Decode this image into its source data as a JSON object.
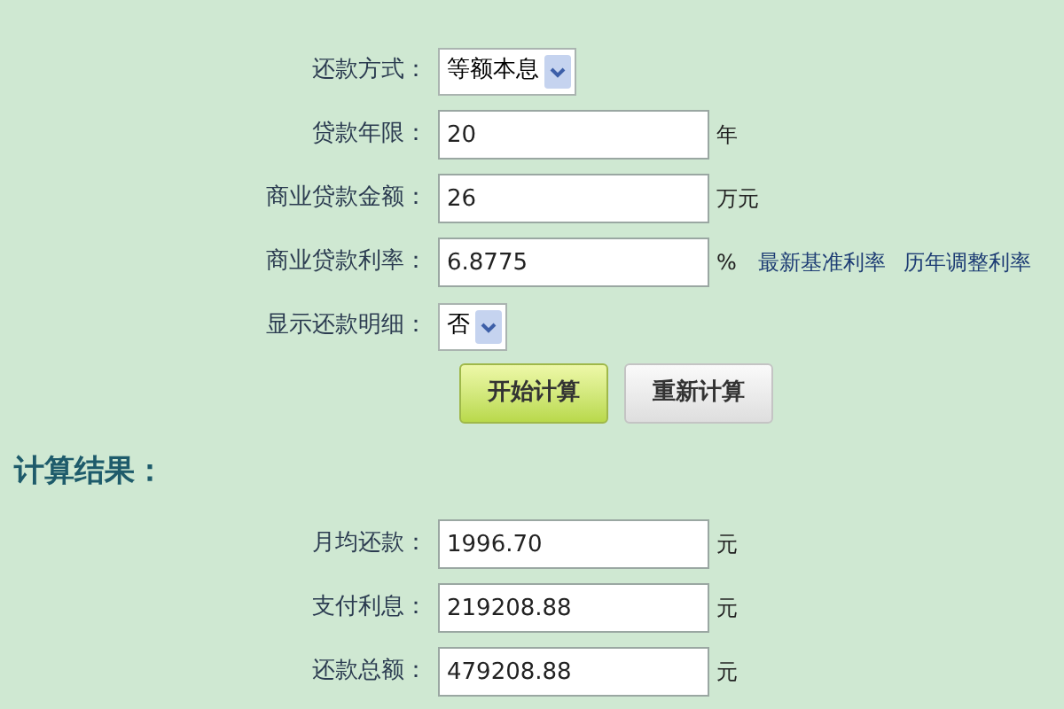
{
  "form": {
    "fields": [
      {
        "kind": "select",
        "label": "还款方式：",
        "value": "等额本息"
      },
      {
        "kind": "input",
        "label": "贷款年限：",
        "value": "20",
        "unit": "年"
      },
      {
        "kind": "input",
        "label": "商业贷款金额：",
        "value": "26",
        "unit": "万元"
      },
      {
        "kind": "input",
        "label": "商业贷款利率：",
        "value": "6.8775",
        "unit": "%",
        "links": [
          "最新基准利率",
          "历年调整利率"
        ]
      },
      {
        "kind": "select",
        "label": "显示还款明细：",
        "value": "否"
      }
    ],
    "buttons": [
      {
        "kind": "primary",
        "label": "开始计算"
      },
      {
        "kind": "secondary",
        "label": "重新计算"
      }
    ]
  },
  "results": {
    "heading": "计算结果：",
    "fields": [
      {
        "kind": "input",
        "label": "月均还款：",
        "value": "1996.70",
        "unit": "元"
      },
      {
        "kind": "input",
        "label": "支付利息：",
        "value": "219208.88",
        "unit": "元"
      },
      {
        "kind": "input",
        "label": "还款总额：",
        "value": "479208.88",
        "unit": "元"
      }
    ]
  }
}
